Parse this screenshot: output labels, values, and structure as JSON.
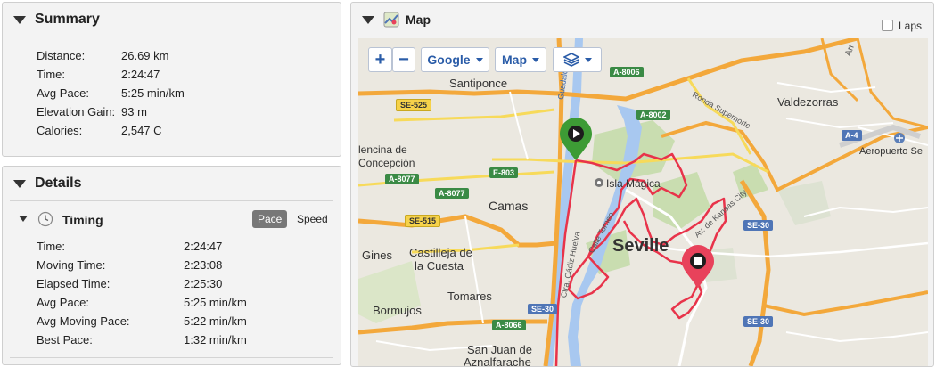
{
  "summary": {
    "title": "Summary",
    "stats": [
      {
        "label": "Distance:",
        "value": "26.69 km"
      },
      {
        "label": "Time:",
        "value": "2:24:47"
      },
      {
        "label": "Avg Pace:",
        "value": "5:25 min/km"
      },
      {
        "label": "Elevation Gain:",
        "value": "93 m"
      },
      {
        "label": "Calories:",
        "value": "2,547 C"
      }
    ]
  },
  "details": {
    "title": "Details",
    "timing_title": "Timing",
    "toggle": {
      "pace": "Pace",
      "speed": "Speed",
      "active": "pace"
    },
    "stats": [
      {
        "label": "Time:",
        "value": "2:24:47"
      },
      {
        "label": "Moving Time:",
        "value": "2:23:08"
      },
      {
        "label": "Elapsed Time:",
        "value": "2:25:30"
      },
      {
        "label": "Avg Pace:",
        "value": "5:25 min/km"
      },
      {
        "label": "Avg Moving Pace:",
        "value": "5:22 min/km"
      },
      {
        "label": "Best Pace:",
        "value": "1:32 min/km"
      }
    ]
  },
  "map": {
    "title": "Map",
    "laps_label": "Laps",
    "laps_checked": false,
    "controls": {
      "zoom_in": "+",
      "zoom_out": "−",
      "provider": "Google",
      "type": "Map"
    },
    "places": {
      "santiponce": "Santiponce",
      "valdezorras": "Valdezorras",
      "encina1": "lencina de",
      "encina2": "Concepción",
      "camas": "Camas",
      "isla": "Isla Mágica",
      "seville": "Seville",
      "gines": "Gines",
      "castilleja1": "Castilleja de",
      "castilleja2": "la Cuesta",
      "tomares": "Tomares",
      "bormujos": "Bormujos",
      "sanjuan1": "San Juan de",
      "sanjuan2": "Aznalfarache",
      "aeropuerto": "Aeropuerto Se",
      "guadalquivir": "Guadalquivir",
      "ronda": "Ronda Supernorte",
      "cadiz": "Ctra. Cádiz Huelva",
      "calletorneo": "Calle Torneo",
      "kansas": "Av. de Kansas City",
      "arr": "Arr"
    },
    "road_tags": {
      "a8006": "A-8006",
      "se525": "SE-525",
      "a8002": "A-8002",
      "e803": "E-803",
      "a8077a": "A-8077",
      "a8077b": "A-8077",
      "se515": "SE-515",
      "a4": "A-4",
      "se30a": "SE-30",
      "se30b": "SE-30",
      "se30c": "SE-30",
      "a8066": "A-8066"
    },
    "colors": {
      "route": "#e8334a",
      "start": "#3d9b35",
      "end": "#e8425b",
      "water": "#a8c8f0",
      "land": "#ebe8e0",
      "park": "#c9ddb0"
    }
  }
}
